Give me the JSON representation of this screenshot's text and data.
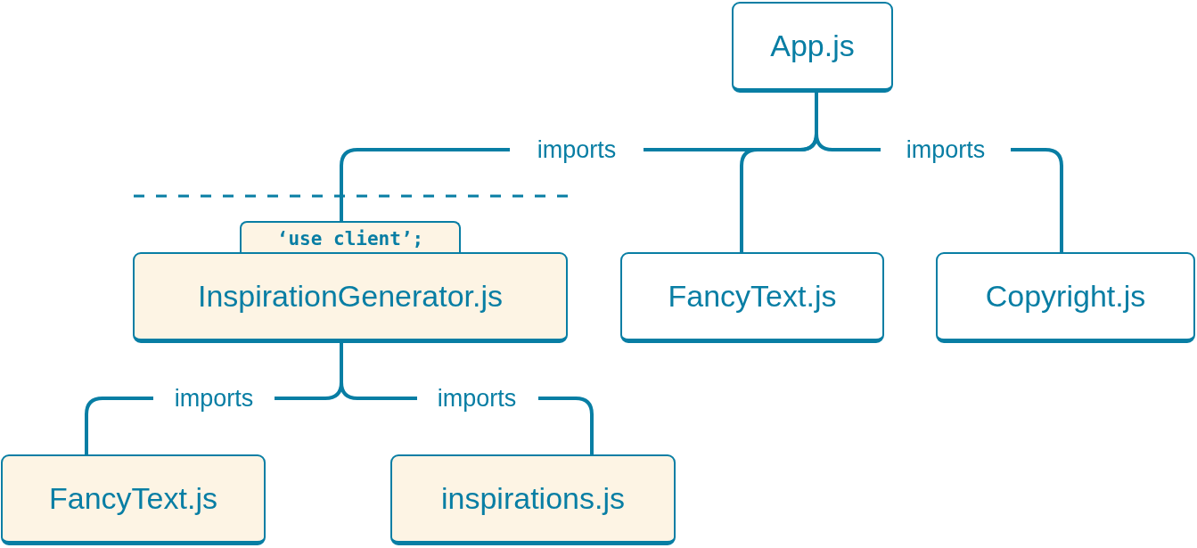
{
  "nodes": [
    {
      "label": "App.js",
      "client": false
    },
    {
      "label": "InspirationGenerator.js",
      "client": true,
      "directive": "‘use client’;"
    },
    {
      "label": "FancyText.js",
      "client": false
    },
    {
      "label": "Copyright.js",
      "client": false
    },
    {
      "label": "FancyText.js",
      "client": true
    },
    {
      "label": "inspirations.js",
      "client": true
    }
  ],
  "edges": [
    {
      "label": "imports"
    },
    {
      "label": "imports"
    },
    {
      "label": "imports"
    },
    {
      "label": "imports"
    }
  ]
}
